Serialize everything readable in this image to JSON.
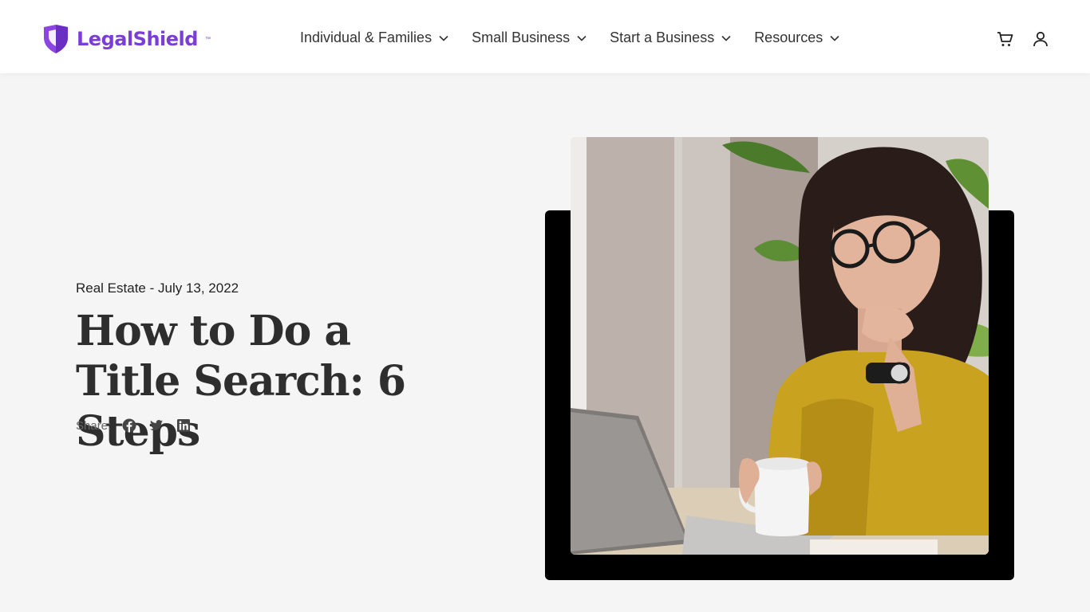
{
  "brand": {
    "name": "LegalShield",
    "tm": "™",
    "accent": "#7a3ed6"
  },
  "nav": {
    "items": [
      {
        "label": "Individual & Families",
        "icon": "chevron-down-icon"
      },
      {
        "label": "Small Business",
        "icon": "chevron-down-icon"
      },
      {
        "label": "Start a Business",
        "icon": "chevron-down-icon"
      },
      {
        "label": "Resources",
        "icon": "chevron-down-icon"
      }
    ]
  },
  "header_icons": [
    "cart-icon",
    "user-icon"
  ],
  "article": {
    "category_date": "Real Estate - July 13, 2022",
    "title": "How to Do a Title Search: 6 Steps",
    "share_label": "Share:",
    "share_icons": [
      "facebook-icon",
      "twitter-icon",
      "linkedin-icon"
    ]
  },
  "hero_image": {
    "alt": "Woman with glasses holding a mug while looking at a laptop"
  }
}
